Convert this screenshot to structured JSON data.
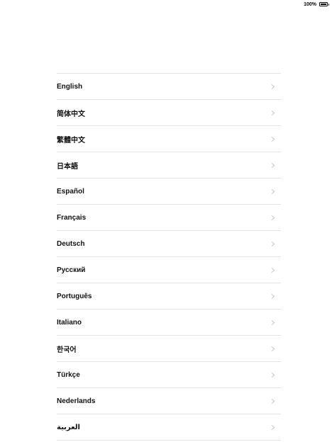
{
  "status_bar": {
    "battery_percent": "100%",
    "battery_level": 1.0
  },
  "languages": [
    {
      "label": "English"
    },
    {
      "label": "简体中文"
    },
    {
      "label": "繁體中文"
    },
    {
      "label": "日本語"
    },
    {
      "label": "Español"
    },
    {
      "label": "Français"
    },
    {
      "label": "Deutsch"
    },
    {
      "label": "Русский"
    },
    {
      "label": "Português"
    },
    {
      "label": "Italiano"
    },
    {
      "label": "한국어"
    },
    {
      "label": "Türkçe"
    },
    {
      "label": "Nederlands"
    },
    {
      "label": "العربية"
    }
  ],
  "icons": {
    "row_disclosure": "chevron-right-icon",
    "battery": "battery-icon"
  }
}
